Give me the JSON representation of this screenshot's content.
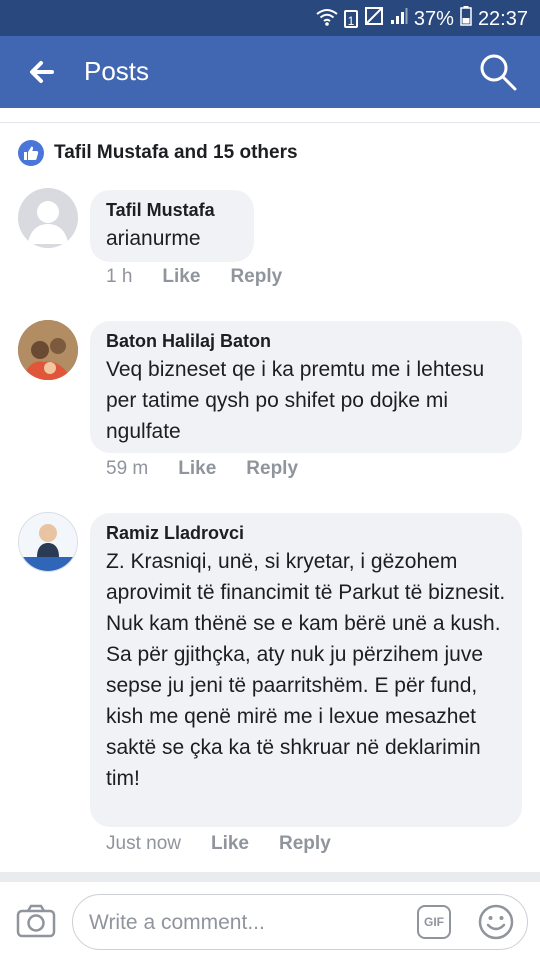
{
  "status_bar": {
    "battery": "37%",
    "time": "22:37",
    "sim_badge": "1"
  },
  "header": {
    "title": "Posts"
  },
  "likes_summary": "Tafil Mustafa and 15 others",
  "comments": [
    {
      "author": "Tafil Mustafa",
      "text": "arianurme",
      "time": "1 h",
      "like_label": "Like",
      "reply_label": "Reply"
    },
    {
      "author": "Baton Halilaj Baton",
      "text": "Veq bizneset qe i ka premtu me i lehtesu per tatime qysh po shifet po dojke mi ngulfate",
      "time": "59 m",
      "like_label": "Like",
      "reply_label": "Reply"
    },
    {
      "author": "Ramiz Lladrovci",
      "text": "Z. Krasniqi, unë, si kryetar, i gëzohem aprovimit të financimit të Parkut të biznesit. Nuk kam thënë se e kam bërë unë a kush. Sa për gjithçka, aty nuk ju përzihem juve sepse ju jeni të paarritshëm. E për fund, kish me qenë mirë me i lexue mesazhet saktë se çka ka të shkruar në deklarimin tim!",
      "time": "Just now",
      "like_label": "Like",
      "reply_label": "Reply"
    }
  ],
  "composer": {
    "placeholder": "Write a comment...",
    "gif_label": "GIF"
  },
  "colors": {
    "brand": "#4267b2",
    "status_bar": "#29487d",
    "bubble": "#f1f2f6",
    "meta_text": "#90949c"
  }
}
